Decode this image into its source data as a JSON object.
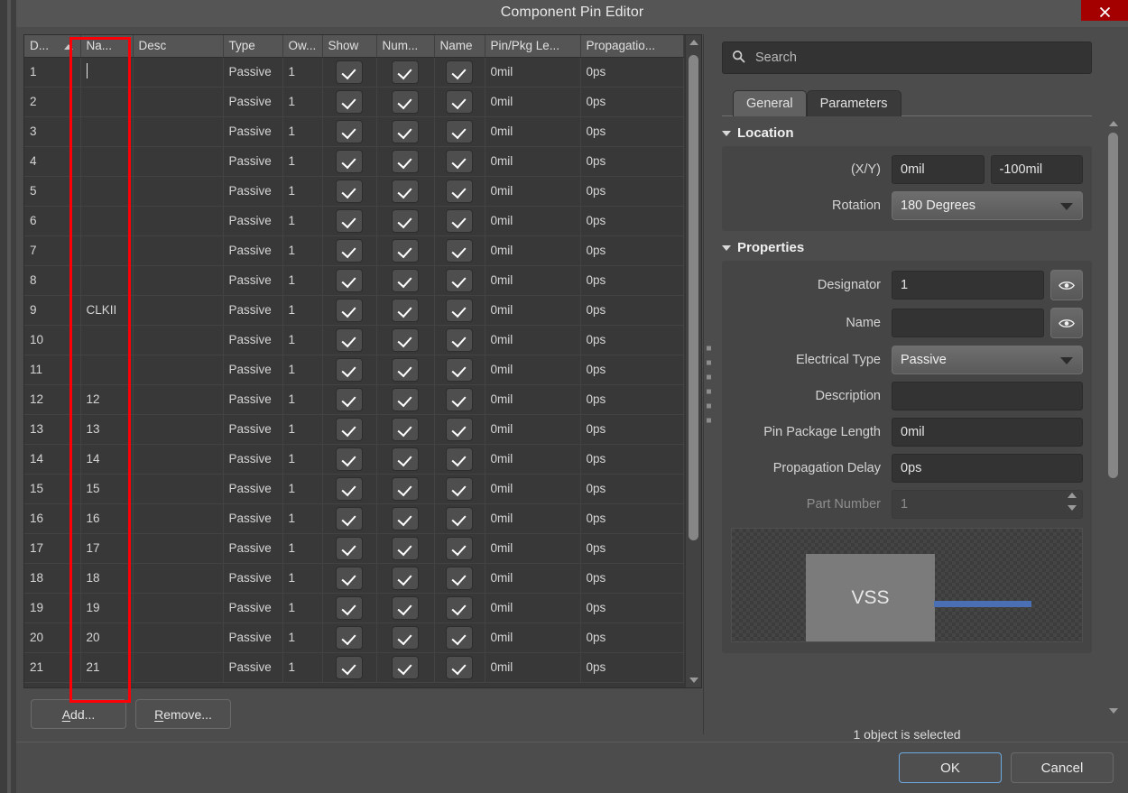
{
  "window": {
    "title": "Component Pin Editor",
    "close_icon": "close-x-icon"
  },
  "table": {
    "columns": [
      {
        "key": "designator",
        "label": "D...",
        "sorted": true
      },
      {
        "key": "name",
        "label": "Na...",
        "sorted": false
      },
      {
        "key": "desc",
        "label": "Desc",
        "sorted": false
      },
      {
        "key": "type",
        "label": "Type",
        "sorted": false
      },
      {
        "key": "owner",
        "label": "Ow...",
        "sorted": false
      },
      {
        "key": "show",
        "label": "Show",
        "sorted": false
      },
      {
        "key": "number",
        "label": "Num...",
        "sorted": false
      },
      {
        "key": "namecol",
        "label": "Name",
        "sorted": false
      },
      {
        "key": "pinpkg",
        "label": "Pin/Pkg Le...",
        "sorted": false
      },
      {
        "key": "propagation",
        "label": "Propagatio...",
        "sorted": false
      }
    ],
    "rows": [
      {
        "designator": "1",
        "name": "",
        "desc": "",
        "type": "Passive",
        "owner": "1",
        "show": true,
        "number": true,
        "namecol": true,
        "pinpkg": "0mil",
        "propagation": "0ps",
        "editing": true
      },
      {
        "designator": "2",
        "name": "",
        "desc": "",
        "type": "Passive",
        "owner": "1",
        "show": true,
        "number": true,
        "namecol": true,
        "pinpkg": "0mil",
        "propagation": "0ps"
      },
      {
        "designator": "3",
        "name": "",
        "desc": "",
        "type": "Passive",
        "owner": "1",
        "show": true,
        "number": true,
        "namecol": true,
        "pinpkg": "0mil",
        "propagation": "0ps"
      },
      {
        "designator": "4",
        "name": "",
        "desc": "",
        "type": "Passive",
        "owner": "1",
        "show": true,
        "number": true,
        "namecol": true,
        "pinpkg": "0mil",
        "propagation": "0ps"
      },
      {
        "designator": "5",
        "name": "",
        "desc": "",
        "type": "Passive",
        "owner": "1",
        "show": true,
        "number": true,
        "namecol": true,
        "pinpkg": "0mil",
        "propagation": "0ps"
      },
      {
        "designator": "6",
        "name": "",
        "desc": "",
        "type": "Passive",
        "owner": "1",
        "show": true,
        "number": true,
        "namecol": true,
        "pinpkg": "0mil",
        "propagation": "0ps"
      },
      {
        "designator": "7",
        "name": "",
        "desc": "",
        "type": "Passive",
        "owner": "1",
        "show": true,
        "number": true,
        "namecol": true,
        "pinpkg": "0mil",
        "propagation": "0ps"
      },
      {
        "designator": "8",
        "name": "",
        "desc": "",
        "type": "Passive",
        "owner": "1",
        "show": true,
        "number": true,
        "namecol": true,
        "pinpkg": "0mil",
        "propagation": "0ps"
      },
      {
        "designator": "9",
        "name": "CLKII",
        "desc": "",
        "type": "Passive",
        "owner": "1",
        "show": true,
        "number": true,
        "namecol": true,
        "pinpkg": "0mil",
        "propagation": "0ps"
      },
      {
        "designator": "10",
        "name": "",
        "desc": "",
        "type": "Passive",
        "owner": "1",
        "show": true,
        "number": true,
        "namecol": true,
        "pinpkg": "0mil",
        "propagation": "0ps"
      },
      {
        "designator": "11",
        "name": "",
        "desc": "",
        "type": "Passive",
        "owner": "1",
        "show": true,
        "number": true,
        "namecol": true,
        "pinpkg": "0mil",
        "propagation": "0ps"
      },
      {
        "designator": "12",
        "name": "12",
        "desc": "",
        "type": "Passive",
        "owner": "1",
        "show": true,
        "number": true,
        "namecol": true,
        "pinpkg": "0mil",
        "propagation": "0ps"
      },
      {
        "designator": "13",
        "name": "13",
        "desc": "",
        "type": "Passive",
        "owner": "1",
        "show": true,
        "number": true,
        "namecol": true,
        "pinpkg": "0mil",
        "propagation": "0ps"
      },
      {
        "designator": "14",
        "name": "14",
        "desc": "",
        "type": "Passive",
        "owner": "1",
        "show": true,
        "number": true,
        "namecol": true,
        "pinpkg": "0mil",
        "propagation": "0ps"
      },
      {
        "designator": "15",
        "name": "15",
        "desc": "",
        "type": "Passive",
        "owner": "1",
        "show": true,
        "number": true,
        "namecol": true,
        "pinpkg": "0mil",
        "propagation": "0ps"
      },
      {
        "designator": "16",
        "name": "16",
        "desc": "",
        "type": "Passive",
        "owner": "1",
        "show": true,
        "number": true,
        "namecol": true,
        "pinpkg": "0mil",
        "propagation": "0ps"
      },
      {
        "designator": "17",
        "name": "17",
        "desc": "",
        "type": "Passive",
        "owner": "1",
        "show": true,
        "number": true,
        "namecol": true,
        "pinpkg": "0mil",
        "propagation": "0ps"
      },
      {
        "designator": "18",
        "name": "18",
        "desc": "",
        "type": "Passive",
        "owner": "1",
        "show": true,
        "number": true,
        "namecol": true,
        "pinpkg": "0mil",
        "propagation": "0ps"
      },
      {
        "designator": "19",
        "name": "19",
        "desc": "",
        "type": "Passive",
        "owner": "1",
        "show": true,
        "number": true,
        "namecol": true,
        "pinpkg": "0mil",
        "propagation": "0ps"
      },
      {
        "designator": "20",
        "name": "20",
        "desc": "",
        "type": "Passive",
        "owner": "1",
        "show": true,
        "number": true,
        "namecol": true,
        "pinpkg": "0mil",
        "propagation": "0ps"
      },
      {
        "designator": "21",
        "name": "21",
        "desc": "",
        "type": "Passive",
        "owner": "1",
        "show": true,
        "number": true,
        "namecol": true,
        "pinpkg": "0mil",
        "propagation": "0ps"
      }
    ]
  },
  "grid_buttons": {
    "add": "Add...",
    "add_accel": "A",
    "remove": "Remove...",
    "remove_accel": "R"
  },
  "search": {
    "placeholder": "Search",
    "value": "",
    "icon": "search-icon"
  },
  "tabs": [
    {
      "label": "General",
      "active": true
    },
    {
      "label": "Parameters",
      "active": false
    }
  ],
  "location": {
    "title": "Location",
    "xy_label": "(X/Y)",
    "x_value": "0mil",
    "y_value": "-100mil",
    "rotation_label": "Rotation",
    "rotation_value": "180 Degrees"
  },
  "properties": {
    "title": "Properties",
    "designator_label": "Designator",
    "designator_value": "1",
    "name_label": "Name",
    "name_value": "",
    "electrical_type_label": "Electrical Type",
    "electrical_type_value": "Passive",
    "description_label": "Description",
    "description_value": "",
    "pin_package_length_label": "Pin Package Length",
    "pin_package_length_value": "0mil",
    "propagation_delay_label": "Propagation Delay",
    "propagation_delay_value": "0ps",
    "part_number_label": "Part Number",
    "part_number_value": "1"
  },
  "preview": {
    "chip_label": "VSS"
  },
  "status": {
    "text": "1 object is selected"
  },
  "footer": {
    "ok": "OK",
    "cancel": "Cancel"
  },
  "colors": {
    "accent_blue": "#6da9e0",
    "close_red": "#a50000",
    "annotation_red": "#fb0007",
    "pin_blue": "#4a6fb5",
    "dialog_bg": "#4c4c4c",
    "grid_bg": "#383838",
    "header_bg": "#555555"
  }
}
